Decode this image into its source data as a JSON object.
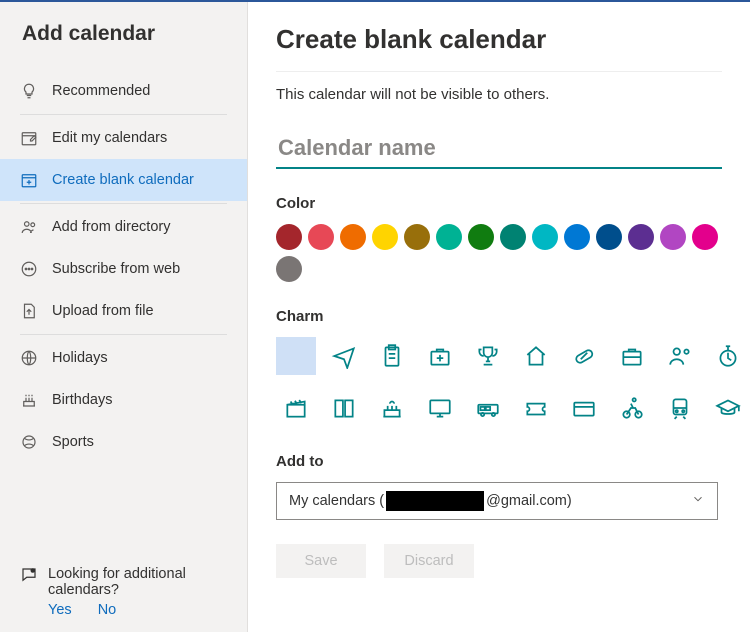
{
  "sidebar": {
    "title": "Add calendar",
    "items": [
      {
        "icon": "bulb",
        "label": "Recommended"
      },
      {
        "icon": "edit-cal",
        "label": "Edit my calendars"
      },
      {
        "icon": "plus-cal",
        "label": "Create blank calendar",
        "selected": true
      },
      {
        "icon": "people",
        "label": "Add from directory"
      },
      {
        "icon": "ellipsis",
        "label": "Subscribe from web"
      },
      {
        "icon": "upload",
        "label": "Upload from file"
      },
      {
        "icon": "globe",
        "label": "Holidays"
      },
      {
        "icon": "cake",
        "label": "Birthdays"
      },
      {
        "icon": "sports",
        "label": "Sports"
      }
    ],
    "footer": {
      "question": "Looking for additional calendars?",
      "yes": "Yes",
      "no": "No"
    }
  },
  "main": {
    "heading": "Create blank calendar",
    "description": "This calendar will not be visible to others.",
    "name_placeholder": "Calendar name",
    "color_label": "Color",
    "colors": [
      "#a4262c",
      "#e74856",
      "#ef6c00",
      "#ffd400",
      "#986f0b",
      "#00b294",
      "#107c10",
      "#008272",
      "#00b7c3",
      "#0078d4",
      "#004e8c",
      "#5c2e91",
      "#b146c2",
      "#e3008c",
      "#7a7574"
    ],
    "charm_label": "Charm",
    "charms": [
      "none",
      "plane",
      "clipboard",
      "firstaid",
      "trophy",
      "home",
      "pill",
      "briefcase",
      "people",
      "stopwatch",
      "clapper",
      "book",
      "cake",
      "monitor",
      "bus",
      "ticket",
      "card",
      "cyclist",
      "train",
      "gradcap"
    ],
    "addto_label": "Add to",
    "account_prefix": "My calendars (",
    "account_suffix": "@gmail.com)",
    "save_label": "Save",
    "discard_label": "Discard"
  }
}
